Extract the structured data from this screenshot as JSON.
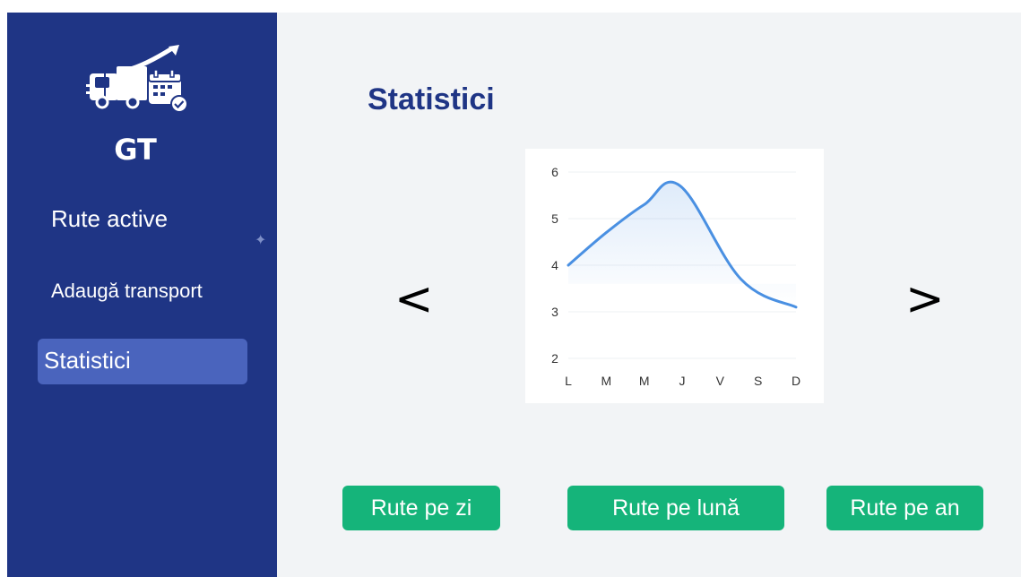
{
  "app": {
    "brand": "GT",
    "logo_icon": "truck-calendar-logo-icon"
  },
  "sidebar": {
    "items": [
      {
        "label": "Rute active",
        "active": false
      },
      {
        "label": "Adaugă transport",
        "active": false
      },
      {
        "label": "Statistici",
        "active": true
      }
    ]
  },
  "main": {
    "title": "Statistici",
    "prev_label": "<",
    "next_label": ">",
    "buttons": [
      "Rute pe zi",
      "Rute pe lună",
      "Rute pe an"
    ]
  },
  "colors": {
    "sidebar": "#1f3585",
    "active_item": "#4a64bd",
    "button": "#15b47a",
    "line": "#4a90e2",
    "title": "#1f3585"
  },
  "chart_data": {
    "type": "line",
    "categories": [
      "L",
      "M",
      "M",
      "J",
      "V",
      "S",
      "D"
    ],
    "values": [
      4.0,
      4.7,
      5.3,
      5.7,
      3.7,
      3.1
    ],
    "x": [
      0,
      1,
      2,
      2.95,
      4.55,
      6
    ],
    "ylim": [
      2,
      6
    ],
    "yticks": [
      2,
      3,
      4,
      5,
      6
    ],
    "grid": true,
    "title": "",
    "xlabel": "",
    "ylabel": ""
  }
}
